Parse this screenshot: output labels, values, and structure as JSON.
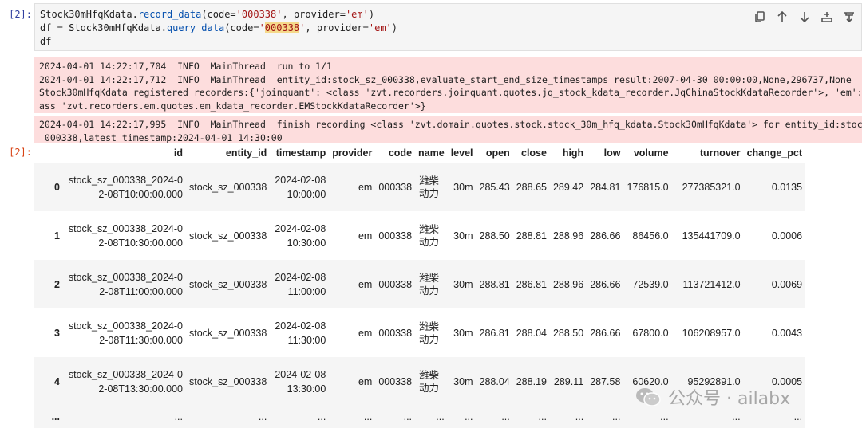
{
  "prompts": {
    "in": "[2]:",
    "out": "[2]:"
  },
  "code": {
    "l1": {
      "a": "Stock30mHfqKdata.",
      "fn": "record_data",
      "b": "(code=",
      "s1": "'000338'",
      "c": ", provider=",
      "s2": "'em'",
      "d": ")"
    },
    "l2": {
      "a": "df = Stock30mHfqKdata.",
      "fn": "query_data",
      "b": "(code=",
      "q1": "'",
      "hl": "000338",
      "q2": "'",
      "c": ", provider=",
      "s2": "'em'",
      "d": ")"
    },
    "l3": "df"
  },
  "toolbar": [
    "copy-icon",
    "arrow-up-icon",
    "arrow-down-icon",
    "insert-below-icon",
    "delete-icon"
  ],
  "stderr": {
    "block1": [
      "2024-04-01 14:22:17,704  INFO  MainThread  run to 1/1",
      "2024-04-01 14:22:17,712  INFO  MainThread  entity_id:stock_sz_000338,evaluate_start_end_size_timestamps result:2007-04-30 00:00:00,None,296737,None",
      "Stock30mHfqKdata registered recorders:{'joinquant': <class 'zvt.recorders.joinquant.quotes.jq_stock_kdata_recorder.JqChinaStockKdataRecorder'>, 'em': <cl",
      "ass 'zvt.recorders.em.quotes.em_kdata_recorder.EMStockKdataRecorder'>}"
    ],
    "block2": [
      "2024-04-01 14:22:17,995  INFO  MainThread  finish recording <class 'zvt.domain.quotes.stock.stock_30m_hfq_kdata.Stock30mHfqKdata'> for entity_id:stock",
      "_000338,latest_timestamp:2024-04-01 14:30:00"
    ]
  },
  "table": {
    "columns": [
      "",
      "id",
      "entity_id",
      "timestamp",
      "provider",
      "code",
      "name",
      "level",
      "open",
      "close",
      "high",
      "low",
      "volume",
      "turnover",
      "change_pct"
    ],
    "rows": [
      {
        "idx": "0",
        "id": "stock_sz_000338_2024-02-08T10:00:00.000",
        "entity_id": "stock_sz_000338",
        "timestamp": "2024-02-08 10:00:00",
        "provider": "em",
        "code": "000338",
        "name": "潍柴动力",
        "level": "30m",
        "open": "285.43",
        "close": "288.65",
        "high": "289.42",
        "low": "284.81",
        "volume": "176815.0",
        "turnover": "277385321.0",
        "change_pct": "0.0135"
      },
      {
        "idx": "1",
        "id": "stock_sz_000338_2024-02-08T10:30:00.000",
        "entity_id": "stock_sz_000338",
        "timestamp": "2024-02-08 10:30:00",
        "provider": "em",
        "code": "000338",
        "name": "潍柴动力",
        "level": "30m",
        "open": "288.50",
        "close": "288.81",
        "high": "288.96",
        "low": "286.66",
        "volume": "86456.0",
        "turnover": "135441709.0",
        "change_pct": "0.0006"
      },
      {
        "idx": "2",
        "id": "stock_sz_000338_2024-02-08T11:00:00.000",
        "entity_id": "stock_sz_000338",
        "timestamp": "2024-02-08 11:00:00",
        "provider": "em",
        "code": "000338",
        "name": "潍柴动力",
        "level": "30m",
        "open": "288.81",
        "close": "286.81",
        "high": "288.96",
        "low": "286.66",
        "volume": "72539.0",
        "turnover": "113721412.0",
        "change_pct": "-0.0069"
      },
      {
        "idx": "3",
        "id": "stock_sz_000338_2024-02-08T11:30:00.000",
        "entity_id": "stock_sz_000338",
        "timestamp": "2024-02-08 11:30:00",
        "provider": "em",
        "code": "000338",
        "name": "潍柴动力",
        "level": "30m",
        "open": "286.81",
        "close": "288.04",
        "high": "288.50",
        "low": "286.66",
        "volume": "67800.0",
        "turnover": "106208957.0",
        "change_pct": "0.0043"
      },
      {
        "idx": "4",
        "id": "stock_sz_000338_2024-02-08T13:30:00.000",
        "entity_id": "stock_sz_000338",
        "timestamp": "2024-02-08 13:30:00",
        "provider": "em",
        "code": "000338",
        "name": "潍柴动力",
        "level": "30m",
        "open": "288.04",
        "close": "288.19",
        "high": "289.11",
        "low": "287.58",
        "volume": "60620.0",
        "turnover": "95292891.0",
        "change_pct": "0.0005"
      }
    ],
    "ellipsis": "..."
  },
  "watermark": {
    "text": "公众号 · ailabx",
    "icon": "wechat-icon"
  }
}
